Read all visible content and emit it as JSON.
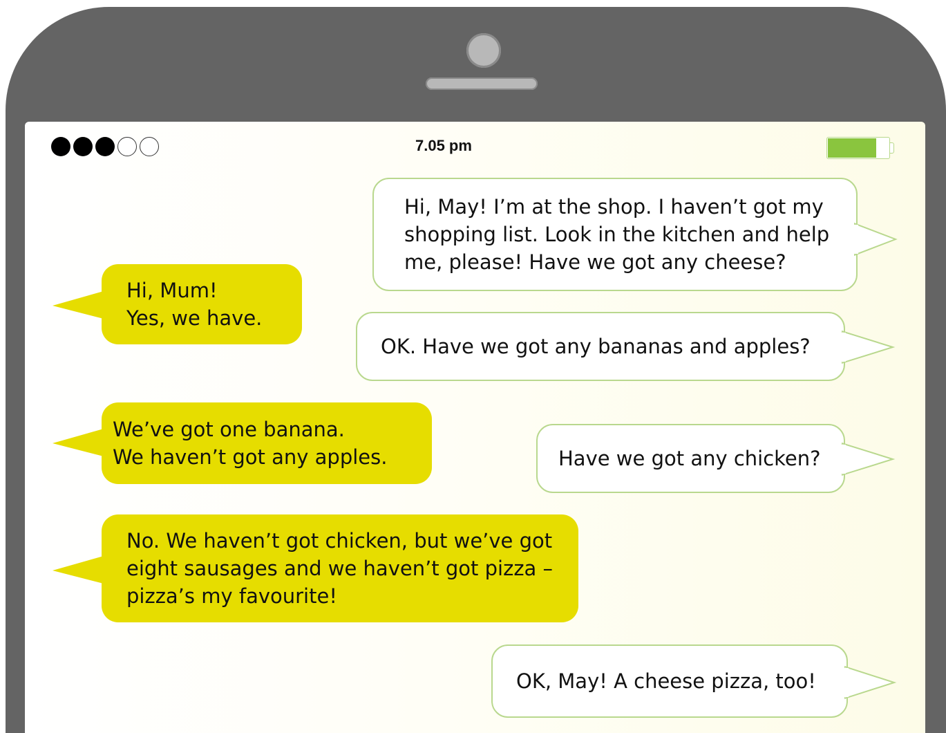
{
  "status_bar": {
    "signal": {
      "filled": 3,
      "total": 5
    },
    "time": "7.05 pm",
    "battery_level": 0.8,
    "battery_color": "#8ac53e"
  },
  "colors": {
    "phone_frame": "#646464",
    "incoming_bubble": "#e6dd00",
    "outgoing_bubble_border": "#b9d88e"
  },
  "messages": [
    {
      "sender": "mum",
      "text": "Hi, May! I’m at the shop. I haven’t got my\nshopping list. Look in the kitchen and help\nme, please! Have we got any cheese?"
    },
    {
      "sender": "may",
      "text": "Hi, Mum!\nYes, we have."
    },
    {
      "sender": "mum",
      "text": "OK. Have we got any bananas and apples?"
    },
    {
      "sender": "may",
      "text": "We’ve got one banana.\nWe haven’t got any apples."
    },
    {
      "sender": "mum",
      "text": "Have we got any chicken?"
    },
    {
      "sender": "may",
      "text": "No. We haven’t got chicken, but we’ve got\neight sausages and we haven’t got pizza –\npizza’s my favourite!"
    },
    {
      "sender": "mum",
      "text": "OK, May! A cheese pizza, too!"
    }
  ]
}
